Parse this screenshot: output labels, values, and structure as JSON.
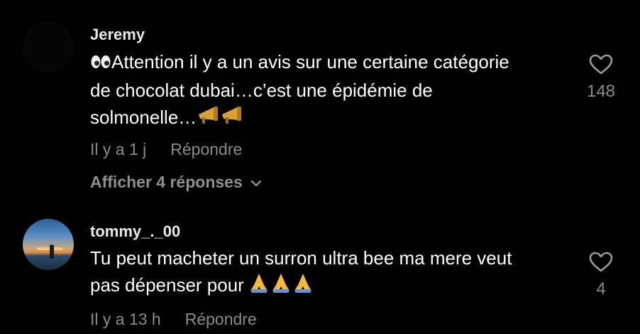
{
  "comments": [
    {
      "username": "Jeremy",
      "text_lines": [
        "Attention il y a un avis sur une certaine catégorie",
        "de chocolat dubai…c’est une épidémie de",
        "solmonelle…"
      ],
      "emojis_lead": "eyes-emoji",
      "emojis_trail": "megaphone-emoji x2",
      "time": "Il y a 1 j",
      "reply_label": "Répondre",
      "view_replies_label": "Afficher 4 réponses",
      "like_count": "148"
    },
    {
      "username": "tommy_._00",
      "text_lines": [
        "Tu peut macheter un surron ultra bee ma mere veut",
        "pas dépenser pour"
      ],
      "emojis_trail": "folded-hands-emoji x3",
      "time": "Il y a 13 h",
      "reply_label": "Répondre",
      "like_count": "4"
    }
  ],
  "colors": {
    "background": "#000000",
    "text": "#ffffff",
    "muted": "#8b8b8b",
    "heart_outline": "#9a9a9a"
  }
}
